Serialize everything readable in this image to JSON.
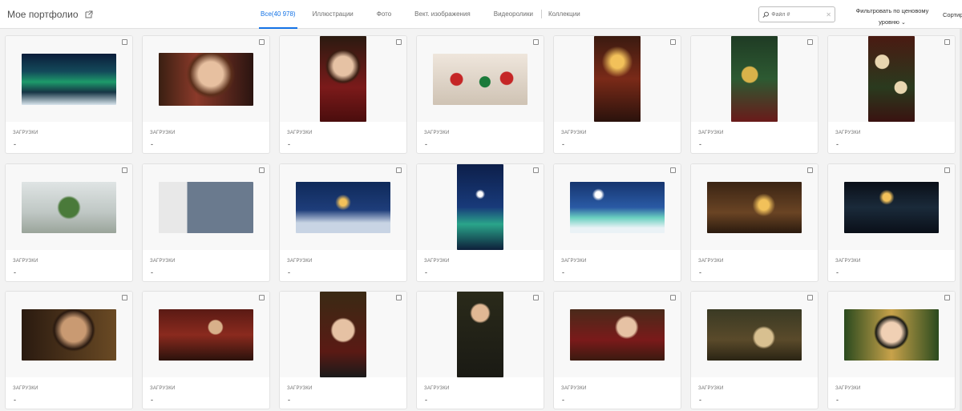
{
  "header": {
    "title": "Мое портфолио",
    "tabs": [
      {
        "label": "Все(40 978)",
        "active": true
      },
      {
        "label": "Иллюстрации",
        "active": false
      },
      {
        "label": "Фото",
        "active": false
      },
      {
        "label": "Вект. изображения",
        "active": false
      },
      {
        "label": "Видеоролики",
        "active": false
      },
      {
        "label": "Коллекции",
        "active": false
      }
    ],
    "search": {
      "placeholder": "Файл #",
      "value": "",
      "clear": "✕"
    },
    "price_filter": {
      "line1": "Фильтровать по ценовому",
      "line2": "уровню",
      "chevron": "⌄"
    },
    "sort_label": "Сортир"
  },
  "colors": {
    "accent": "#1473e6",
    "card_bg": "#ffffff",
    "page_bg": "#f3f3f3"
  },
  "cards": [
    {
      "image": "aurora-tree",
      "orientation": "land",
      "label": "ЗАГРУЗКИ",
      "value": "-"
    },
    {
      "image": "woman-portrait",
      "orientation": "land2",
      "label": "ЗАГРУЗКИ",
      "value": "-"
    },
    {
      "image": "woman-champagne",
      "orientation": "port",
      "label": "ЗАГРУЗКИ",
      "value": "-"
    },
    {
      "image": "ornaments-garland",
      "orientation": "land",
      "label": "ЗАГРУЗКИ",
      "value": "-"
    },
    {
      "image": "christmas-dining-room",
      "orientation": "port",
      "label": "ЗАГРУЗКИ",
      "value": "-"
    },
    {
      "image": "festive-table-setting",
      "orientation": "port",
      "label": "ЗАГРУЗКИ",
      "value": "-"
    },
    {
      "image": "holiday-feast",
      "orientation": "port",
      "label": "ЗАГРУЗКИ",
      "value": "-"
    },
    {
      "image": "greenhouse-tree",
      "orientation": "land",
      "label": "ЗАГРУЗКИ",
      "value": "-"
    },
    {
      "image": "city-view-tree",
      "orientation": "land",
      "label": "ЗАГРУЗКИ",
      "value": "-"
    },
    {
      "image": "snowy-village-tree",
      "orientation": "land",
      "label": "ЗАГРУЗКИ",
      "value": "-"
    },
    {
      "image": "star-night-forest",
      "orientation": "port",
      "label": "ЗАГРУЗКИ",
      "value": "-"
    },
    {
      "image": "star-aurora-landscape",
      "orientation": "land",
      "label": "ЗАГРУЗКИ",
      "value": "-"
    },
    {
      "image": "cozy-living-room",
      "orientation": "land",
      "label": "ЗАГРУЗКИ",
      "value": "-"
    },
    {
      "image": "window-silhouette",
      "orientation": "land",
      "label": "ЗАГРУЗКИ",
      "value": "-"
    },
    {
      "image": "woman-gold-jewelry",
      "orientation": "land",
      "label": "ЗАГРУЗКИ",
      "value": "-"
    },
    {
      "image": "friends-party",
      "orientation": "land",
      "label": "ЗАГРУЗКИ",
      "value": "-"
    },
    {
      "image": "smiling-boy",
      "orientation": "port",
      "label": "ЗАГРУЗКИ",
      "value": "-"
    },
    {
      "image": "woman-glass-toast",
      "orientation": "port",
      "label": "ЗАГРУЗКИ",
      "value": "-"
    },
    {
      "image": "woman-fireplace-toast",
      "orientation": "land",
      "label": "ЗАГРУЗКИ",
      "value": "-"
    },
    {
      "image": "gifts-pine-branches",
      "orientation": "land",
      "label": "ЗАГРУЗКИ",
      "value": "-"
    },
    {
      "image": "girl-bokeh-lights",
      "orientation": "land",
      "label": "ЗАГРУЗКИ",
      "value": "-"
    }
  ]
}
